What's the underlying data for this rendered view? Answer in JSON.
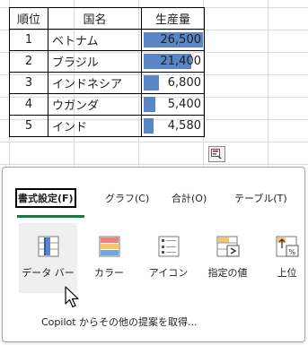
{
  "table": {
    "headers": [
      "順位",
      "国名",
      "生産量"
    ],
    "rows": [
      {
        "rank": "1",
        "country": "ベトナム",
        "production": "26,500",
        "ratio": 1.0
      },
      {
        "rank": "2",
        "country": "ブラジル",
        "production": "21,400",
        "ratio": 0.81
      },
      {
        "rank": "3",
        "country": "インドネシア",
        "production": "6,800",
        "ratio": 0.26
      },
      {
        "rank": "4",
        "country": "ウガンダ",
        "production": "5,400",
        "ratio": 0.2
      },
      {
        "rank": "5",
        "country": "インド",
        "production": "4,580",
        "ratio": 0.17
      }
    ],
    "bar_color": "#5b86c5"
  },
  "quick_analysis": {
    "button_icon": "quick-analysis-icon",
    "tabs": [
      {
        "label": "書式設定(F)",
        "active": true
      },
      {
        "label": "グラフ(C)",
        "active": false
      },
      {
        "label": "合計(O)",
        "active": false
      },
      {
        "label": "テーブル(T)",
        "active": false
      }
    ],
    "options": [
      {
        "label": "データ バー",
        "icon": "data-bar-icon",
        "selected": true
      },
      {
        "label": "カラー",
        "icon": "color-scale-icon",
        "selected": false
      },
      {
        "label": "アイコン",
        "icon": "icon-set-icon",
        "selected": false
      },
      {
        "label": "指定の値",
        "icon": "greater-than-icon",
        "selected": false
      },
      {
        "label": "上位",
        "icon": "top-percent-icon",
        "selected": false
      }
    ],
    "copilot_text": "Copilot からその他の提案を取得...",
    "accent_color": "#107c41"
  }
}
